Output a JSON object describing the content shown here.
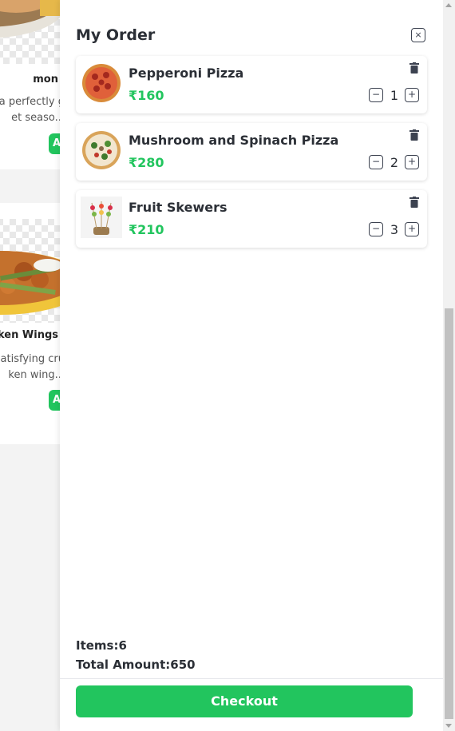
{
  "background_menu": {
    "cards": [
      {
        "name": "mon",
        "desc": "a perfectly g\net seaso...",
        "add_label": "A"
      },
      {
        "name": "cken Wings",
        "desc": "atisfying cru\nken wing...",
        "add_label": "A"
      }
    ]
  },
  "drawer": {
    "title": "My Order",
    "close_icon": "close-icon",
    "items": [
      {
        "name": "Pepperoni Pizza",
        "price": "₹160",
        "qty": "1",
        "thumb_icon": "pepperoni-pizza-image"
      },
      {
        "name": "Mushroom and Spinach Pizza",
        "price": "₹280",
        "qty": "2",
        "thumb_icon": "mushroom-spinach-pizza-image"
      },
      {
        "name": "Fruit Skewers",
        "price": "₹210",
        "qty": "3",
        "thumb_icon": "fruit-skewers-image"
      }
    ],
    "summary": {
      "items_label": "Items:6",
      "total_label": "Total Amount:650"
    },
    "checkout_label": "Checkout"
  },
  "colors": {
    "accent": "#22c55e",
    "text": "#2b2f36"
  }
}
